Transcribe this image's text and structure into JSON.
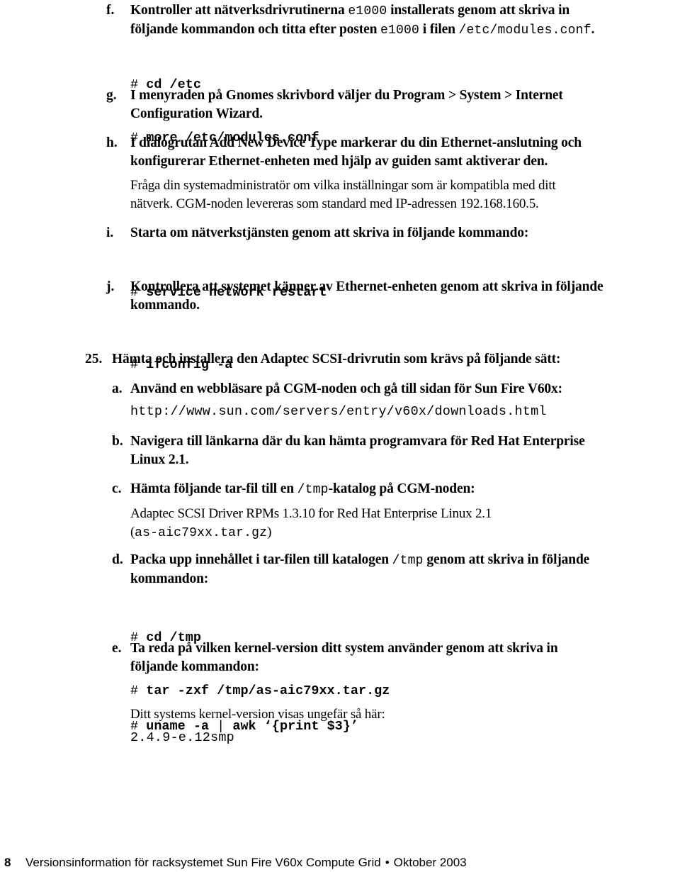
{
  "steps": {
    "f": {
      "marker": "f.",
      "text_1": "Kontroller att nätverksdrivrutinerna ",
      "code_1": "e1000",
      "text_2": " installerats genom att skriva in",
      "line2_text_1": "följande kommandon och titta efter posten ",
      "line2_code_1": "e1000",
      "line2_text_2": " i filen ",
      "line2_code_2": "/etc/modules.conf",
      "line2_text_3": ".",
      "commands": [
        {
          "prompt": "#",
          "cmd": "cd /etc"
        },
        {
          "prompt": "#",
          "cmd": "more /etc/modules.conf"
        }
      ]
    },
    "g": {
      "marker": "g.",
      "line_1": "I menyraden på Gnomes skrivbord väljer du Program > System > Internet",
      "line_2": "Configuration Wizard."
    },
    "h": {
      "marker": "h.",
      "line_1": "I dialogrutan Add New Device Type markerar du din Ethernet-anslutning och",
      "line_2": "konfigurerar Ethernet-enheten med hjälp av guiden samt aktiverar den.",
      "note_1": "Fråga din systemadministratör om vilka inställningar som är kompatibla med ditt",
      "note_2": "nätverk. CGM-noden levereras som standard med IP-adressen 192.168.160.5."
    },
    "i": {
      "marker": "i.",
      "line_1": "Starta om nätverkstjänsten genom att skriva in följande kommando:",
      "commands": [
        {
          "prompt": "#",
          "cmd": "service network restart"
        }
      ]
    },
    "j": {
      "marker": "j.",
      "line_1": "Kontrollera att systemet känner av Ethernet-enheten genom att skriva in följande",
      "line_2": "kommando.",
      "commands": [
        {
          "prompt": "#",
          "cmd": "ifconfig -a"
        }
      ]
    }
  },
  "step25": {
    "marker": "25.",
    "line_1": "Hämta och installera den Adaptec SCSI-drivrutin som krävs på följande sätt:",
    "a": {
      "marker": "a.",
      "line_1": "Använd en webbläsare på CGM-noden och gå till sidan för Sun Fire V60x:",
      "url": "http://www.sun.com/servers/entry/v60x/downloads.html"
    },
    "b": {
      "marker": "b.",
      "line_1": "Navigera till länkarna där du kan hämta programvara för Red Hat Enterprise",
      "line_2": "Linux 2.1."
    },
    "c": {
      "marker": "c.",
      "text_1": "Hämta följande tar-fil till en ",
      "code_1": "/tmp",
      "text_2": "-katalog på CGM-noden:",
      "file_desc": "Adaptec SCSI Driver RPMs 1.3.10 for Red Hat Enterprise Linux 2.1",
      "file_open": "(",
      "file_name": "as-aic79xx.tar.gz",
      "file_close": ")"
    },
    "d": {
      "marker": "d.",
      "text_1": "Packa upp innehållet i tar-filen till katalogen ",
      "code_1": "/tmp",
      "text_2": " genom att skriva in följande",
      "line_2": "kommandon:",
      "commands": [
        {
          "prompt": "#",
          "cmd": "cd /tmp"
        },
        {
          "prompt": "#",
          "cmd": "tar -zxf /tmp/as-aic79xx.tar.gz"
        }
      ]
    },
    "e": {
      "marker": "e.",
      "line_1": "Ta reda på vilken kernel-version ditt system använder genom att skriva in",
      "line_2": "följande kommandon:",
      "command": {
        "prompt": "#",
        "cmd_1": "uname -a ",
        "pipe": "|",
        "cmd_2": " awk ‘{print $3}’"
      },
      "result_intro": "Ditt systems kernel-version visas ungefär så här:",
      "result": "2.4.9-e.12smp"
    }
  },
  "footer": {
    "page_number": "8",
    "title": "Versionsinformation för racksystemet Sun Fire V60x Compute Grid",
    "bullet": "•",
    "date": "Oktober 2003"
  }
}
